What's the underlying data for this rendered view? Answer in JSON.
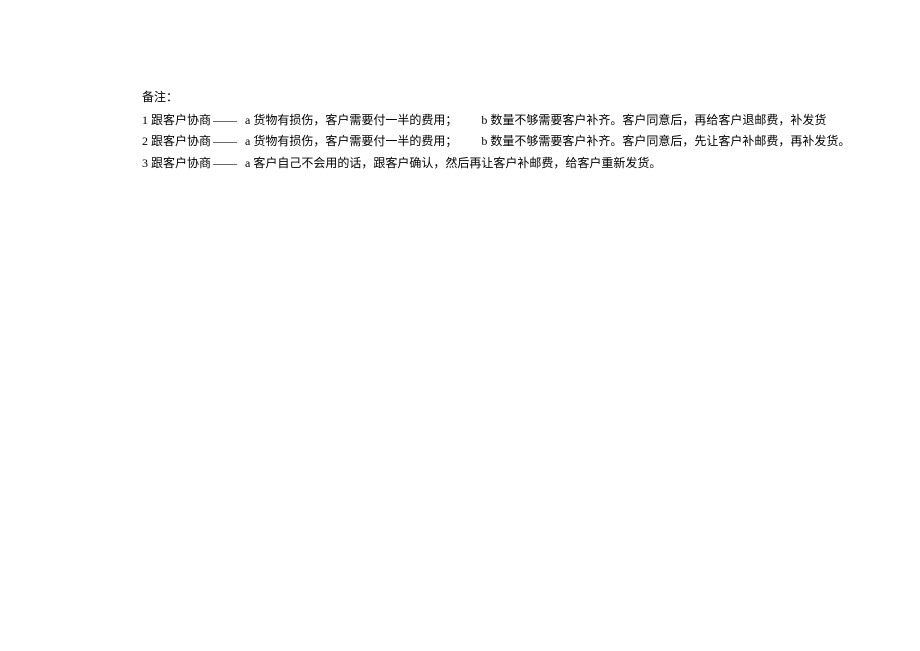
{
  "notes": {
    "header": "备注：",
    "lines": [
      {
        "prefix": "1 跟客户协商",
        "dash": "——",
        "part_a": "a 货物有损伤，客户需要付一半的费用；",
        "part_b": "b 数量不够需要客户补齐。客户同意后，再给客户退邮费，补发货"
      },
      {
        "prefix": "2 跟客户协商",
        "dash": "——",
        "part_a": "a 货物有损伤，客户需要付一半的费用；",
        "part_b": "b 数量不够需要客户补齐。客户同意后，先让客户补邮费，再补发货。"
      },
      {
        "prefix": "3  跟客户协商",
        "dash": "——",
        "part_a": "a 客户自己不会用的话，跟客户确认，然后再让客户补邮费，给客户重新发货。",
        "part_b": ""
      }
    ]
  }
}
